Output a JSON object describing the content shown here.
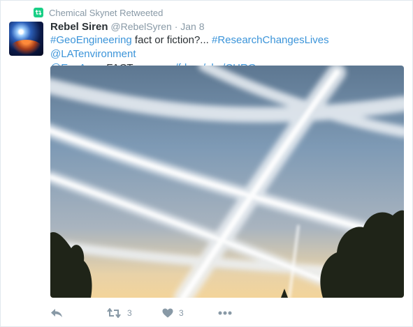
{
  "context": {
    "text": "Chemical Skynet Retweeted"
  },
  "author": {
    "name": "Rebel Siren",
    "handle": "@RebelSyren",
    "separator": "·",
    "date": "Jan 8"
  },
  "tweet": {
    "parts": [
      {
        "text": "#GeoEngineering",
        "link": true
      },
      {
        "text": " fact or fiction?... ",
        "link": false
      },
      {
        "text": "#ResearchChangesLives",
        "link": true
      },
      {
        "text": " ",
        "link": false
      },
      {
        "text": "@LATenvironment",
        "link": true
      },
      {
        "text": "@EnvAm",
        "link": true
      },
      {
        "text": " ...FACT: ",
        "link": false
      },
      {
        "text": "gpo.gov/fdsys/pkg/CHRG…",
        "link": true
      }
    ]
  },
  "media": {
    "alt_subject": "contrail-sky-photo"
  },
  "actions": {
    "reply_count": "",
    "retweet_count": "3",
    "like_count": "3"
  },
  "colors": {
    "link": "#3b94d9",
    "muted": "#8899a6",
    "retweet_badge": "#19cf86"
  }
}
